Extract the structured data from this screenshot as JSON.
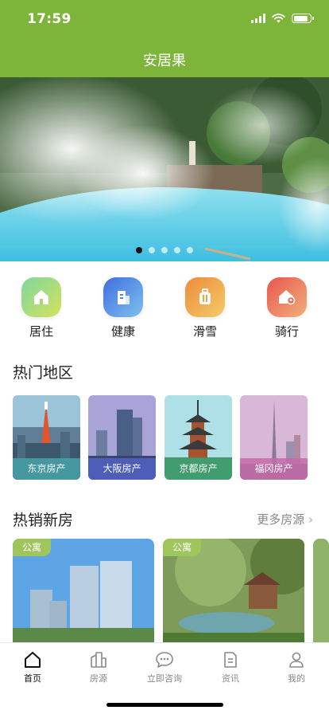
{
  "status_bar": {
    "time": "17:59",
    "battery_level": 0.85
  },
  "header": {
    "title": "安居果"
  },
  "banner": {
    "slide_count": 5,
    "active_index": 0
  },
  "categories": [
    {
      "label": "居住",
      "icon": "house-icon",
      "color": "#9ccb5a"
    },
    {
      "label": "健康",
      "icon": "building-icon",
      "color": "#4f86e8"
    },
    {
      "label": "滑雪",
      "icon": "luggage-icon",
      "color": "#f0a23a"
    },
    {
      "label": "骑行",
      "icon": "house-location-icon",
      "color": "#ea6a55"
    }
  ],
  "hot_regions": {
    "title": "热门地区",
    "items": [
      {
        "label": "东京房产",
        "label_color": "#47a3a8"
      },
      {
        "label": "大阪房产",
        "label_color": "#5263c7"
      },
      {
        "label": "京都房产",
        "label_color": "#3fa070"
      },
      {
        "label": "福冈房产",
        "label_color": "#c56aa8"
      }
    ]
  },
  "new_houses": {
    "title": "热销新房",
    "more_label": "更多房源",
    "items": [
      {
        "badge": "公寓"
      },
      {
        "badge": "公寓"
      }
    ]
  },
  "tabbar": {
    "items": [
      {
        "label": "首页",
        "icon": "home-icon",
        "active": true
      },
      {
        "label": "房源",
        "icon": "listings-icon",
        "active": false
      },
      {
        "label": "立即咨询",
        "icon": "chat-icon",
        "active": false
      },
      {
        "label": "资讯",
        "icon": "news-icon",
        "active": false
      },
      {
        "label": "我的",
        "icon": "profile-icon",
        "active": false
      }
    ]
  },
  "colors": {
    "primary": "#7db53a",
    "badge": "#9fc65d"
  }
}
